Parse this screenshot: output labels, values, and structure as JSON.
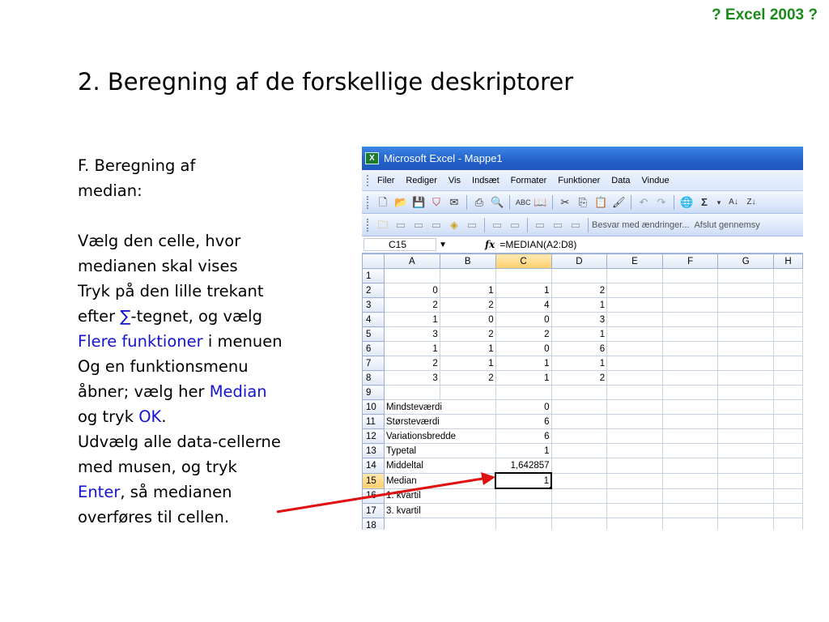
{
  "badge": "? Excel 2003 ?",
  "slide_title": "2. Beregning af de forskellige deskriptorer",
  "instructions": {
    "heading_line1": "F. Beregning af",
    "heading_line2": "median:",
    "l1": "Vælg den celle, hvor",
    "l2": "medianen skal vises",
    "l3": "Tryk på den lille trekant",
    "l4a": "efter ",
    "sigma": "∑",
    "l4b": "-tegnet, og vælg",
    "l5a": "Flere funktioner",
    "l5b": " i menuen",
    "l6": "Og en funktionsmenu",
    "l7a": "åbner; vælg her ",
    "l7b": "Median",
    "l8a": "og tryk ",
    "l8b": "OK",
    "l8c": ".",
    "l9": "Udvælg alle data-cellerne",
    "l10": "med musen, og tryk",
    "l11a": "Enter",
    "l11b": ", så medianen",
    "l12": "overføres til cellen."
  },
  "excel": {
    "title": "Microsoft Excel - Mappe1",
    "app_icon": "X",
    "menu": [
      "Filer",
      "Rediger",
      "Vis",
      "Indsæt",
      "Formater",
      "Funktioner",
      "Data",
      "Vindue"
    ],
    "toolbar2_text": "Besvar med ændringer...",
    "toolbar2_text2": "Afslut gennemsy",
    "name_box": "C15",
    "fx": "fx",
    "formula": "=MEDIAN(A2:D8)",
    "columns": [
      "",
      "A",
      "B",
      "C",
      "D",
      "E",
      "F",
      "G",
      "H"
    ],
    "rows": [
      {
        "n": "1",
        "a": "",
        "b": "",
        "c": "",
        "d": ""
      },
      {
        "n": "2",
        "a": "0",
        "b": "1",
        "c": "1",
        "d": "2"
      },
      {
        "n": "3",
        "a": "2",
        "b": "2",
        "c": "4",
        "d": "1"
      },
      {
        "n": "4",
        "a": "1",
        "b": "0",
        "c": "0",
        "d": "3"
      },
      {
        "n": "5",
        "a": "3",
        "b": "2",
        "c": "2",
        "d": "1"
      },
      {
        "n": "6",
        "a": "1",
        "b": "1",
        "c": "0",
        "d": "6"
      },
      {
        "n": "7",
        "a": "2",
        "b": "1",
        "c": "1",
        "d": "1"
      },
      {
        "n": "8",
        "a": "3",
        "b": "2",
        "c": "1",
        "d": "2"
      },
      {
        "n": "9",
        "a": "",
        "b": "",
        "c": "",
        "d": ""
      },
      {
        "n": "10",
        "label": "Mindsteværdi",
        "c": "0"
      },
      {
        "n": "11",
        "label": "Størsteværdi",
        "c": "6"
      },
      {
        "n": "12",
        "label": "Variationsbredde",
        "c": "6"
      },
      {
        "n": "13",
        "label": "Typetal",
        "c": "1"
      },
      {
        "n": "14",
        "label": "Middeltal",
        "c": "1,642857"
      },
      {
        "n": "15",
        "label": "Median",
        "c": "1"
      },
      {
        "n": "16",
        "label": "1. kvartil",
        "c": ""
      },
      {
        "n": "17",
        "label": "3. kvartil",
        "c": ""
      },
      {
        "n": "18",
        "label": "",
        "c": ""
      }
    ]
  },
  "colors": {
    "highlight": "#1414d0",
    "badge": "#1a8a1a",
    "arrow": "#e01010"
  }
}
